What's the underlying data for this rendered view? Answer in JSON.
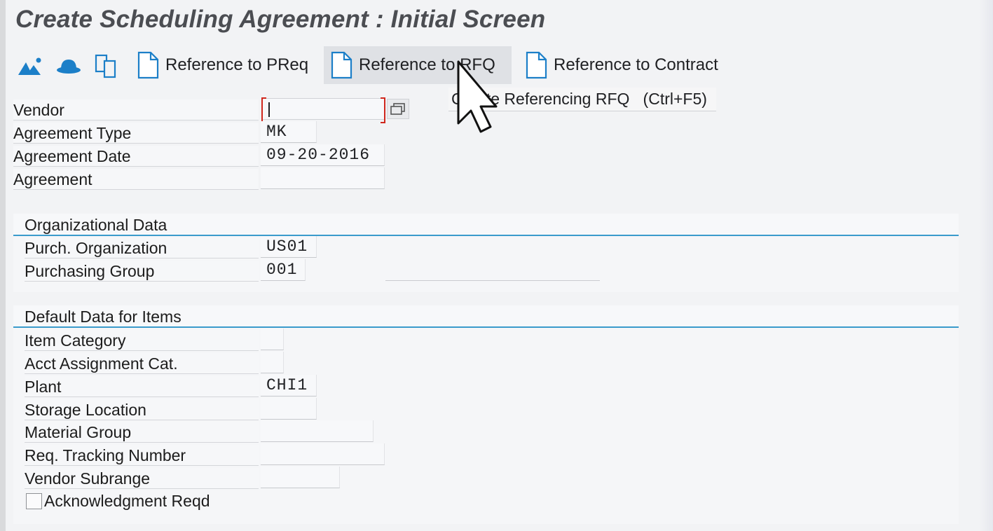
{
  "screen": {
    "title": "Create Scheduling Agreement : Initial Screen"
  },
  "toolbar": {
    "icons": [
      "mountain-icon",
      "hat-icon",
      "copy-icon"
    ],
    "preq_label": "Reference to PReq",
    "rfq_label": "Reference to RFQ",
    "contract_label": "Reference to Contract"
  },
  "tooltip": {
    "text": "Create Referencing RFQ   (Ctrl+F5)"
  },
  "header_fields": {
    "vendor": {
      "label": "Vendor",
      "value": ""
    },
    "agreement_type": {
      "label": "Agreement Type",
      "value": "MK"
    },
    "agreement_date": {
      "label": "Agreement Date",
      "value": "09-20-2016"
    },
    "agreement": {
      "label": "Agreement",
      "value": ""
    }
  },
  "org_data": {
    "title": "Organizational Data",
    "purch_org": {
      "label": "Purch. Organization",
      "value": "US01"
    },
    "purch_group": {
      "label": "Purchasing Group",
      "value": "001"
    }
  },
  "default_data": {
    "title": "Default Data for Items",
    "item_category": {
      "label": "Item Category",
      "value": ""
    },
    "acct_assignment": {
      "label": "Acct Assignment Cat.",
      "value": ""
    },
    "plant": {
      "label": "Plant",
      "value": "CHI1"
    },
    "storage_location": {
      "label": "Storage Location",
      "value": ""
    },
    "material_group": {
      "label": "Material Group",
      "value": ""
    },
    "req_tracking": {
      "label": "Req. Tracking Number",
      "value": ""
    },
    "vendor_subrange": {
      "label": "Vendor Subrange",
      "value": ""
    },
    "acknowledgment": {
      "label": "Acknowledgment Reqd",
      "checked": false
    }
  },
  "colors": {
    "accent": "#3a9bcc",
    "required": "#d0271d",
    "icon_blue": "#1c7fc8"
  }
}
